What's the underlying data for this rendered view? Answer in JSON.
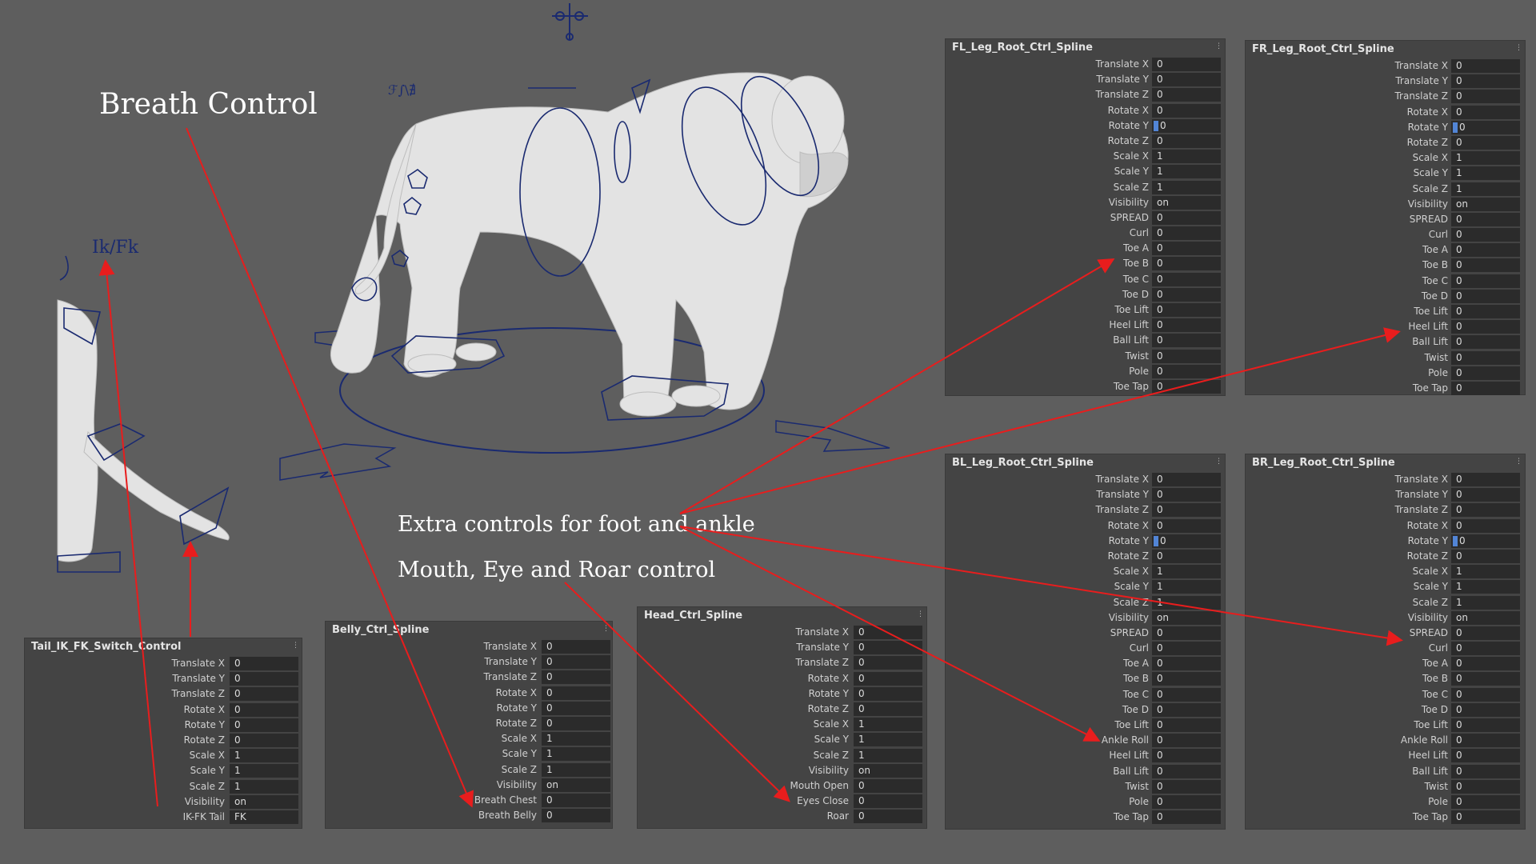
{
  "annotations": {
    "breath": "Breath Control",
    "foot": "Extra controls for foot and ankle",
    "mouth": "Mouth, Eye and Roar control"
  },
  "viewport": {
    "ikfk_label": "Ik/Fk",
    "rig_marker": "ℱ∫\\∄"
  },
  "colors": {
    "background": "#5e5e5e",
    "panel": "#444444",
    "field": "#2b2b2b",
    "rig_curve": "#1a2a70",
    "annotation_arrow": "#e81d1d",
    "highlight": "#5285d6"
  },
  "panels": {
    "fl": {
      "title": "FL_Leg_Root_Ctrl_Spline",
      "rows": [
        {
          "label": "Translate X",
          "value": "0"
        },
        {
          "label": "Translate Y",
          "value": "0"
        },
        {
          "label": "Translate Z",
          "value": "0"
        },
        {
          "label": "Rotate X",
          "value": "0"
        },
        {
          "label": "Rotate Y",
          "value": "0",
          "mark": true
        },
        {
          "label": "Rotate Z",
          "value": "0"
        },
        {
          "label": "Scale X",
          "value": "1"
        },
        {
          "label": "Scale Y",
          "value": "1"
        },
        {
          "label": "Scale Z",
          "value": "1"
        },
        {
          "label": "Visibility",
          "value": "on"
        },
        {
          "label": "SPREAD",
          "value": "0"
        },
        {
          "label": "Curl",
          "value": "0"
        },
        {
          "label": "Toe A",
          "value": "0"
        },
        {
          "label": "Toe B",
          "value": "0"
        },
        {
          "label": "Toe C",
          "value": "0"
        },
        {
          "label": "Toe D",
          "value": "0"
        },
        {
          "label": "Toe Lift",
          "value": "0"
        },
        {
          "label": "Heel Lift",
          "value": "0"
        },
        {
          "label": "Ball Lift",
          "value": "0"
        },
        {
          "label": "Twist",
          "value": "0"
        },
        {
          "label": "Pole",
          "value": "0"
        },
        {
          "label": "Toe Tap",
          "value": "0"
        }
      ]
    },
    "fr": {
      "title": "FR_Leg_Root_Ctrl_Spline",
      "rows": [
        {
          "label": "Translate X",
          "value": "0"
        },
        {
          "label": "Translate Y",
          "value": "0"
        },
        {
          "label": "Translate Z",
          "value": "0"
        },
        {
          "label": "Rotate X",
          "value": "0"
        },
        {
          "label": "Rotate Y",
          "value": "0",
          "mark": true
        },
        {
          "label": "Rotate Z",
          "value": "0"
        },
        {
          "label": "Scale X",
          "value": "1"
        },
        {
          "label": "Scale Y",
          "value": "1"
        },
        {
          "label": "Scale Z",
          "value": "1"
        },
        {
          "label": "Visibility",
          "value": "on"
        },
        {
          "label": "SPREAD",
          "value": "0"
        },
        {
          "label": "Curl",
          "value": "0"
        },
        {
          "label": "Toe A",
          "value": "0"
        },
        {
          "label": "Toe B",
          "value": "0"
        },
        {
          "label": "Toe C",
          "value": "0"
        },
        {
          "label": "Toe D",
          "value": "0"
        },
        {
          "label": "Toe Lift",
          "value": "0"
        },
        {
          "label": "Heel Lift",
          "value": "0"
        },
        {
          "label": "Ball Lift",
          "value": "0"
        },
        {
          "label": "Twist",
          "value": "0"
        },
        {
          "label": "Pole",
          "value": "0"
        },
        {
          "label": "Toe Tap",
          "value": "0"
        }
      ]
    },
    "bl": {
      "title": "BL_Leg_Root_Ctrl_Spline",
      "rows": [
        {
          "label": "Translate X",
          "value": "0"
        },
        {
          "label": "Translate Y",
          "value": "0"
        },
        {
          "label": "Translate Z",
          "value": "0"
        },
        {
          "label": "Rotate X",
          "value": "0"
        },
        {
          "label": "Rotate Y",
          "value": "0",
          "mark": true
        },
        {
          "label": "Rotate Z",
          "value": "0"
        },
        {
          "label": "Scale X",
          "value": "1"
        },
        {
          "label": "Scale Y",
          "value": "1"
        },
        {
          "label": "Scale Z",
          "value": "1"
        },
        {
          "label": "Visibility",
          "value": "on"
        },
        {
          "label": "SPREAD",
          "value": "0"
        },
        {
          "label": "Curl",
          "value": "0"
        },
        {
          "label": "Toe A",
          "value": "0"
        },
        {
          "label": "Toe B",
          "value": "0"
        },
        {
          "label": "Toe C",
          "value": "0"
        },
        {
          "label": "Toe D",
          "value": "0"
        },
        {
          "label": "Toe Lift",
          "value": "0"
        },
        {
          "label": "Ankle Roll",
          "value": "0"
        },
        {
          "label": "Heel Lift",
          "value": "0"
        },
        {
          "label": "Ball Lift",
          "value": "0"
        },
        {
          "label": "Twist",
          "value": "0"
        },
        {
          "label": "Pole",
          "value": "0"
        },
        {
          "label": "Toe Tap",
          "value": "0"
        }
      ]
    },
    "br": {
      "title": "BR_Leg_Root_Ctrl_Spline",
      "rows": [
        {
          "label": "Translate X",
          "value": "0"
        },
        {
          "label": "Translate Y",
          "value": "0"
        },
        {
          "label": "Translate Z",
          "value": "0"
        },
        {
          "label": "Rotate X",
          "value": "0"
        },
        {
          "label": "Rotate Y",
          "value": "0",
          "mark": true
        },
        {
          "label": "Rotate Z",
          "value": "0"
        },
        {
          "label": "Scale X",
          "value": "1"
        },
        {
          "label": "Scale Y",
          "value": "1"
        },
        {
          "label": "Scale Z",
          "value": "1"
        },
        {
          "label": "Visibility",
          "value": "on"
        },
        {
          "label": "SPREAD",
          "value": "0"
        },
        {
          "label": "Curl",
          "value": "0"
        },
        {
          "label": "Toe A",
          "value": "0"
        },
        {
          "label": "Toe B",
          "value": "0"
        },
        {
          "label": "Toe C",
          "value": "0"
        },
        {
          "label": "Toe D",
          "value": "0"
        },
        {
          "label": "Toe Lift",
          "value": "0"
        },
        {
          "label": "Ankle Roll",
          "value": "0"
        },
        {
          "label": "Heel Lift",
          "value": "0"
        },
        {
          "label": "Ball Lift",
          "value": "0"
        },
        {
          "label": "Twist",
          "value": "0"
        },
        {
          "label": "Pole",
          "value": "0"
        },
        {
          "label": "Toe Tap",
          "value": "0"
        }
      ]
    },
    "tail": {
      "title": "Tail_IK_FK_Switch_Control",
      "rows": [
        {
          "label": "Translate X",
          "value": "0"
        },
        {
          "label": "Translate Y",
          "value": "0"
        },
        {
          "label": "Translate Z",
          "value": "0"
        },
        {
          "label": "Rotate X",
          "value": "0"
        },
        {
          "label": "Rotate Y",
          "value": "0"
        },
        {
          "label": "Rotate Z",
          "value": "0"
        },
        {
          "label": "Scale X",
          "value": "1"
        },
        {
          "label": "Scale Y",
          "value": "1"
        },
        {
          "label": "Scale Z",
          "value": "1"
        },
        {
          "label": "Visibility",
          "value": "on"
        },
        {
          "label": "IK-FK Tail",
          "value": "FK"
        }
      ]
    },
    "belly": {
      "title": "Belly_Ctrl_Spline",
      "rows": [
        {
          "label": "Translate X",
          "value": "0"
        },
        {
          "label": "Translate Y",
          "value": "0"
        },
        {
          "label": "Translate Z",
          "value": "0"
        },
        {
          "label": "Rotate X",
          "value": "0"
        },
        {
          "label": "Rotate Y",
          "value": "0"
        },
        {
          "label": "Rotate Z",
          "value": "0"
        },
        {
          "label": "Scale X",
          "value": "1"
        },
        {
          "label": "Scale Y",
          "value": "1"
        },
        {
          "label": "Scale Z",
          "value": "1"
        },
        {
          "label": "Visibility",
          "value": "on"
        },
        {
          "label": "Breath Chest",
          "value": "0"
        },
        {
          "label": "Breath Belly",
          "value": "0"
        }
      ]
    },
    "head": {
      "title": "Head_Ctrl_Spline",
      "rows": [
        {
          "label": "Translate X",
          "value": "0"
        },
        {
          "label": "Translate Y",
          "value": "0"
        },
        {
          "label": "Translate Z",
          "value": "0"
        },
        {
          "label": "Rotate X",
          "value": "0"
        },
        {
          "label": "Rotate Y",
          "value": "0"
        },
        {
          "label": "Rotate Z",
          "value": "0"
        },
        {
          "label": "Scale X",
          "value": "1"
        },
        {
          "label": "Scale Y",
          "value": "1"
        },
        {
          "label": "Scale Z",
          "value": "1"
        },
        {
          "label": "Visibility",
          "value": "on"
        },
        {
          "label": "Mouth Open",
          "value": "0"
        },
        {
          "label": "Eyes Close",
          "value": "0"
        },
        {
          "label": "Roar",
          "value": "0"
        }
      ]
    }
  }
}
